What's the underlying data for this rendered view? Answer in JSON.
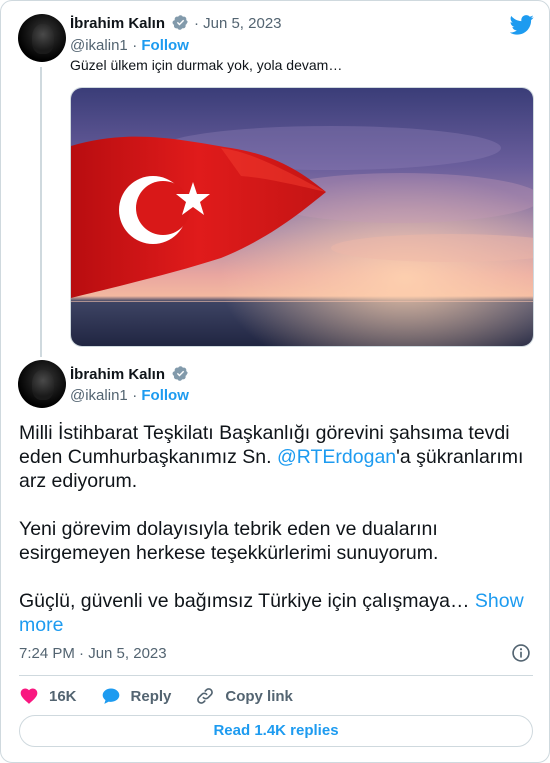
{
  "quoted_tweet": {
    "author_name": "İbrahim Kalın",
    "date": "Jun 5, 2023",
    "handle": "@ikalin1",
    "follow_label": "Follow",
    "text": "Güzel ülkem için durmak yok, yola devam…"
  },
  "main_tweet": {
    "author_name": "İbrahim Kalın",
    "handle": "@ikalin1",
    "follow_label": "Follow",
    "text_part1": "Milli İstihbarat Teşkilatı Başkanlığı görevini şahsıma tevdi eden Cumhurbaşkanımız Sn. ",
    "mention": "@RTErdogan",
    "text_part2": "'a şükranlarımı arz ediyorum.\n\nYeni görevim dolayısıyla tebrik eden ve dualarını esirgemeyen herkese teşekkürlerimi sunuyorum.\n\nGüçlü, güvenli ve bağımsız Türkiye için çalışmaya… ",
    "show_more": "Show more",
    "timestamp": "7:24 PM · Jun 5, 2023"
  },
  "actions": {
    "likes": "16K",
    "reply_label": "Reply",
    "copy_link_label": "Copy link"
  },
  "read_replies_label": "Read 1.4K replies",
  "colors": {
    "accent": "#1d9bf0",
    "like": "#f91880",
    "muted": "#536471",
    "border": "#cfd9de"
  },
  "icons": [
    "twitter-logo-icon",
    "verified-badge-icon",
    "heart-icon",
    "reply-bubble-icon",
    "link-icon",
    "info-icon"
  ]
}
